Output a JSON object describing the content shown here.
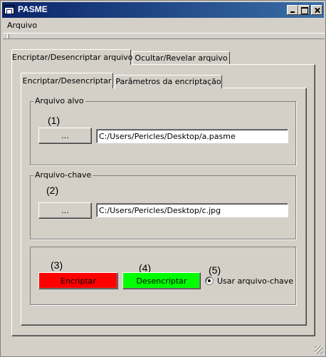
{
  "window": {
    "title": "PASME"
  },
  "menubar": {
    "items": [
      "Arquivo"
    ]
  },
  "tabs": [
    {
      "label": "Encriptar/Desencriptar arquivo",
      "active": true
    },
    {
      "label": "Ocultar/Revelar arquivo",
      "active": false
    }
  ],
  "subtabs": [
    {
      "label": "Encriptar/Desencriptar",
      "active": true
    },
    {
      "label": "Parâmetros da encriptação",
      "active": false
    }
  ],
  "target_group": {
    "title": "Arquivo alvo",
    "step": "(1)",
    "browse_label": "...",
    "path": "C:/Users/Pericles/Desktop/a.pasme"
  },
  "key_group": {
    "title": "Arquivo-chave",
    "step": "(2)",
    "browse_label": "...",
    "path": "C:/Users/Pericles/Desktop/c.jpg"
  },
  "actions": {
    "encrypt": {
      "step": "(3)",
      "label": "Encriptar",
      "color": "#ff0000"
    },
    "decrypt": {
      "step": "(4)",
      "label": "Desencriptar",
      "color": "#00ff00"
    },
    "use_keyfile": {
      "step": "(5)",
      "label": "Usar arquivo-chave",
      "checked": true
    }
  }
}
